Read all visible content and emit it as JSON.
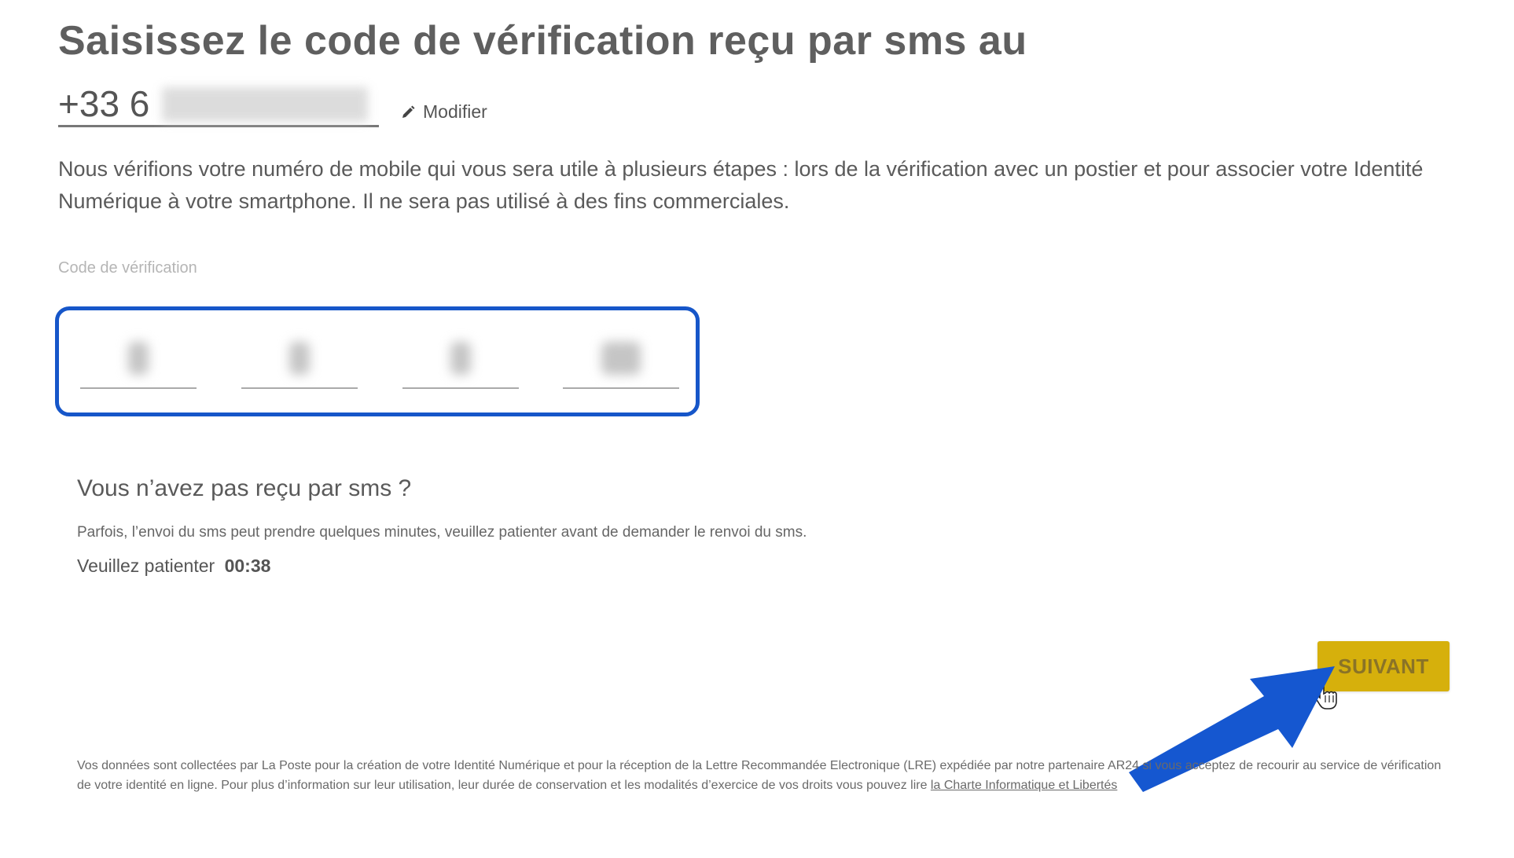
{
  "header": {
    "title": "Saisissez le code de vérification reçu par sms au",
    "phone_prefix": "+33 6",
    "modify_label": "Modifier"
  },
  "description": "Nous vérifions votre numéro de mobile qui vous sera utile à plusieurs étapes : lors de la vérification avec un postier et pour associer votre Identité Numérique à votre smartphone. Il ne sera pas utilisé à des fins commerciales.",
  "code": {
    "label": "Code de vérification",
    "digit_count": 4
  },
  "resend": {
    "title": "Vous n’avez pas reçu par sms ?",
    "info": "Parfois, l’envoi du sms peut prendre quelques minutes, veuillez patienter avant de demander le renvoi du sms.",
    "wait_label": "Veuillez patienter",
    "timer": "00:38"
  },
  "actions": {
    "next_label": "SUIVANT"
  },
  "footer": {
    "text": "Vos données sont collectées par La Poste pour la création de votre Identité Numérique et pour la réception de la Lettre Recommandée Electronique (LRE) expédiée par notre partenaire AR24 si vous acceptez de recourir au service de vérification de votre identité en ligne. Pour plus d’information sur leur utilisation, leur durée de conservation et les modalités d’exercice de vos droits vous pouvez lire",
    "link": "la Charte Informatique et Libertés"
  },
  "colors": {
    "highlight_blue": "#1656c9",
    "button_yellow": "#d6b00c",
    "title_gray": "#5f5f5f"
  },
  "icons": {
    "modify": "pencil-icon",
    "pointer": "hand-pointer-icon",
    "annotation": "arrow-icon"
  }
}
